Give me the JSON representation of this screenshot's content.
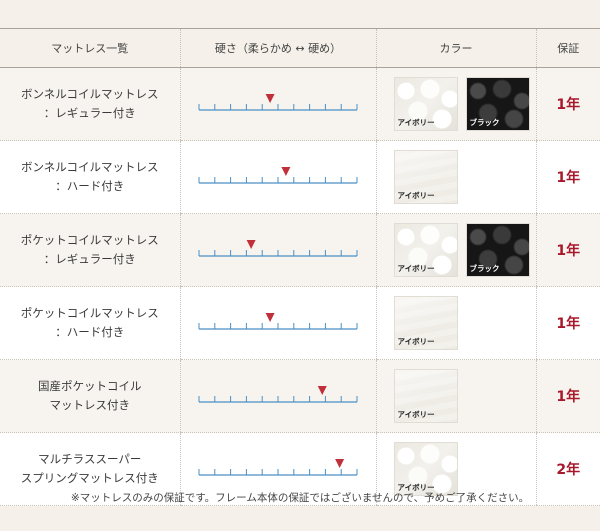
{
  "header": {
    "col_name": "マットレス一覧",
    "col_firmness": "硬さ（柔らかめ ↔ 硬め）",
    "col_color": "カラー",
    "col_warranty": "保証"
  },
  "rows": [
    {
      "name_line1": "ボンネルコイルマットレス",
      "name_line2": "：レギュラー付き",
      "firmness_fraction": 0.45,
      "colors": [
        {
          "label": "アイボリー",
          "swatch": "ivory-quilted"
        },
        {
          "label": "ブラック",
          "swatch": "black-quilted"
        }
      ],
      "warranty": "1年"
    },
    {
      "name_line1": "ボンネルコイルマットレス",
      "name_line2": "：ハード付き",
      "firmness_fraction": 0.55,
      "colors": [
        {
          "label": "アイボリー",
          "swatch": "ivory-plain"
        }
      ],
      "warranty": "1年"
    },
    {
      "name_line1": "ポケットコイルマットレス",
      "name_line2": "：レギュラー付き",
      "firmness_fraction": 0.33,
      "colors": [
        {
          "label": "アイボリー",
          "swatch": "ivory-quilted"
        },
        {
          "label": "ブラック",
          "swatch": "black-quilted"
        }
      ],
      "warranty": "1年"
    },
    {
      "name_line1": "ポケットコイルマットレス",
      "name_line2": "：ハード付き",
      "firmness_fraction": 0.45,
      "colors": [
        {
          "label": "アイボリー",
          "swatch": "ivory-plain"
        }
      ],
      "warranty": "1年"
    },
    {
      "name_line1": "国産ポケットコイル",
      "name_line2": "マットレス付き",
      "firmness_fraction": 0.78,
      "colors": [
        {
          "label": "アイボリー",
          "swatch": "ivory-plain"
        }
      ],
      "warranty": "1年"
    },
    {
      "name_line1": "マルチラススーパー",
      "name_line2": "スプリングマットレス付き",
      "firmness_fraction": 0.89,
      "colors": [
        {
          "label": "アイボリー",
          "swatch": "ivory-quilted"
        }
      ],
      "warranty": "2年"
    }
  ],
  "footer_note": "※マットレスのみの保証です。フレーム本体の保証ではございませんので、予めご了承ください。",
  "colors": {
    "scale_line": "#4a8fc4",
    "marker": "#c0303a",
    "warranty_text": "#a8182b"
  }
}
